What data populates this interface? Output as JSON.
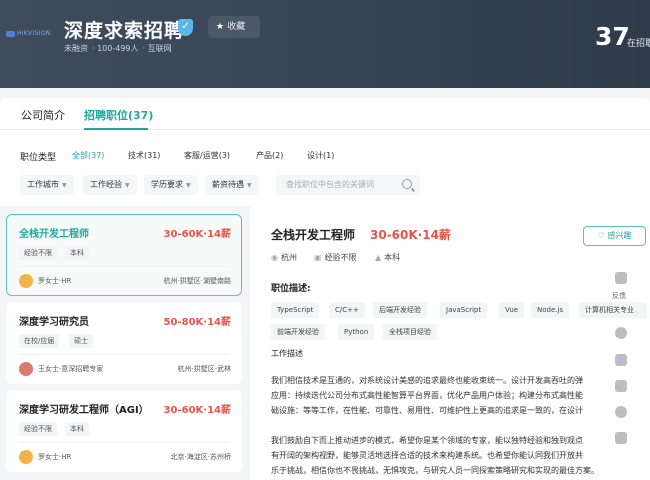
{
  "header": {
    "logo_text": "HIKVISION",
    "company_name": "深度求索招聘",
    "favorite_label": "收藏",
    "meta": [
      "未融资",
      "100-499人",
      "互联网"
    ],
    "count": "37",
    "count_label": "在招职"
  },
  "tabs": [
    {
      "label": "公司简介"
    },
    {
      "label": "招聘职位(37)"
    }
  ],
  "categories": {
    "label": "职位类型",
    "items": [
      "全部(37)",
      "技术(31)",
      "客服/运营(3)",
      "产品(2)",
      "设计(1)"
    ]
  },
  "filters": [
    "工作城市",
    "工作经验",
    "学历要求",
    "薪资待遇"
  ],
  "search": {
    "placeholder": "查找职位中包含的关键词"
  },
  "jobs": [
    {
      "title": "全栈开发工程师",
      "salary": "30-60K·14薪",
      "tags": [
        "经验不限",
        "本科"
      ],
      "recruiter": "罗女士·HR",
      "location": "杭州·拱墅区·湖墅南路"
    },
    {
      "title": "深度学习研究员",
      "salary": "50-80K·14薪",
      "tags": [
        "在校/应届",
        "硕士"
      ],
      "recruiter": "王女士·意深招聘专家",
      "location": "杭州·拱墅区·武林"
    },
    {
      "title": "深度学习研发工程师（AGI）",
      "salary": "30-60K·14薪",
      "tags": [
        "经验不限",
        "本科"
      ],
      "recruiter": "罗女士·HR",
      "location": "北京·海淀区·苏州桥"
    }
  ],
  "detail": {
    "title": "全栈开发工程师",
    "salary": "30-60K·14薪",
    "interest_label": "感兴趣",
    "meta": [
      "杭州",
      "经验不限",
      "本科"
    ],
    "section_title": "职位描述:",
    "skills": [
      "TypeScript",
      "C/C++",
      "后端开发经验",
      "JavaScript",
      "Vue",
      "Node.js",
      "计算机相关专业",
      "前端开发经验",
      "Python",
      "全栈项目经验"
    ],
    "desc_head": "工作描述",
    "paragraphs": [
      "我们相信技术是互通的，对系统设计美感的追求最终也能收束统一。设计开发高吞吐的弹",
      "应用：持续迭代公司分布式高性能智算平台界面，优化产品用户体验；构建分布式高性能",
      "础设施：等等工作，在性能、可靠性、易用性、可维护性上更高的追求是一致的，在设计",
      "我们鼓励自下而上推动进步的模式，希望你是某个领域的专家，能以独特经验和独到观点",
      "有开阔的架构视野，能够灵活地选择合适的技术来构建系统。也希望你能认同我们开放共",
      "乐于挑战，相信你也不畏挑战，无惧攻克，与研究人员一同探索策略研究和实现的最佳方案。"
    ]
  },
  "toolbar": {
    "feedback_label": "反馈"
  }
}
